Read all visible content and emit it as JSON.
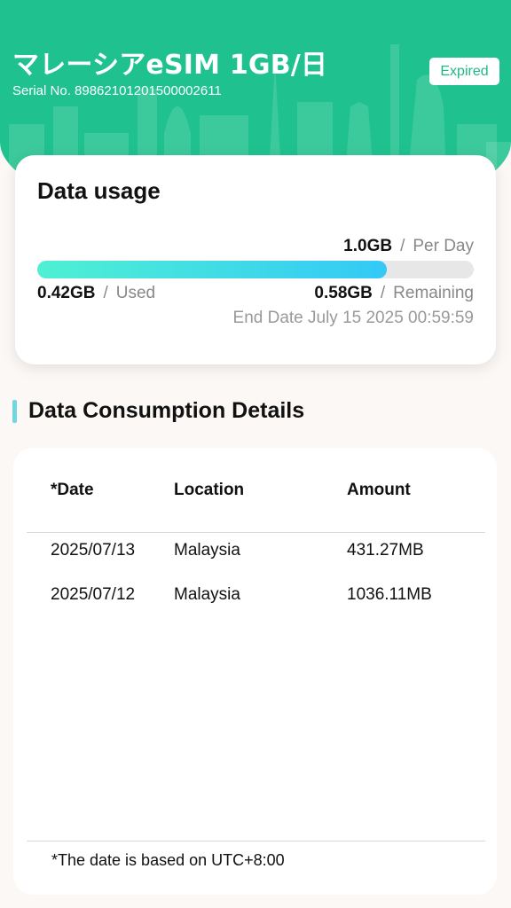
{
  "header": {
    "title": "マレーシアeSIM 1GB/日",
    "serial": "Serial No. 89862101201500002611",
    "status_badge": "Expired",
    "colors": {
      "brand": "#1fc28e",
      "badge_text": "#1fb989"
    }
  },
  "usage": {
    "title": "Data usage",
    "per_day_value": "1.0GB",
    "per_day_label": "Per Day",
    "separator": "/",
    "used_value": "0.42GB",
    "used_label": "Used",
    "remaining_value": "0.58GB",
    "remaining_label": "Remaining",
    "end_date": "End Date July 15 2025 00:59:59",
    "progress_fraction": 0.8
  },
  "details": {
    "section_title": "Data Consumption Details",
    "columns": [
      "*Date",
      "Location",
      "Amount"
    ],
    "rows": [
      {
        "date": "2025/07/13",
        "location": "Malaysia",
        "amount": "431.27MB"
      },
      {
        "date": "2025/07/12",
        "location": "Malaysia",
        "amount": "1036.11MB"
      }
    ],
    "footnote": "*The date is based on UTC+8:00"
  }
}
